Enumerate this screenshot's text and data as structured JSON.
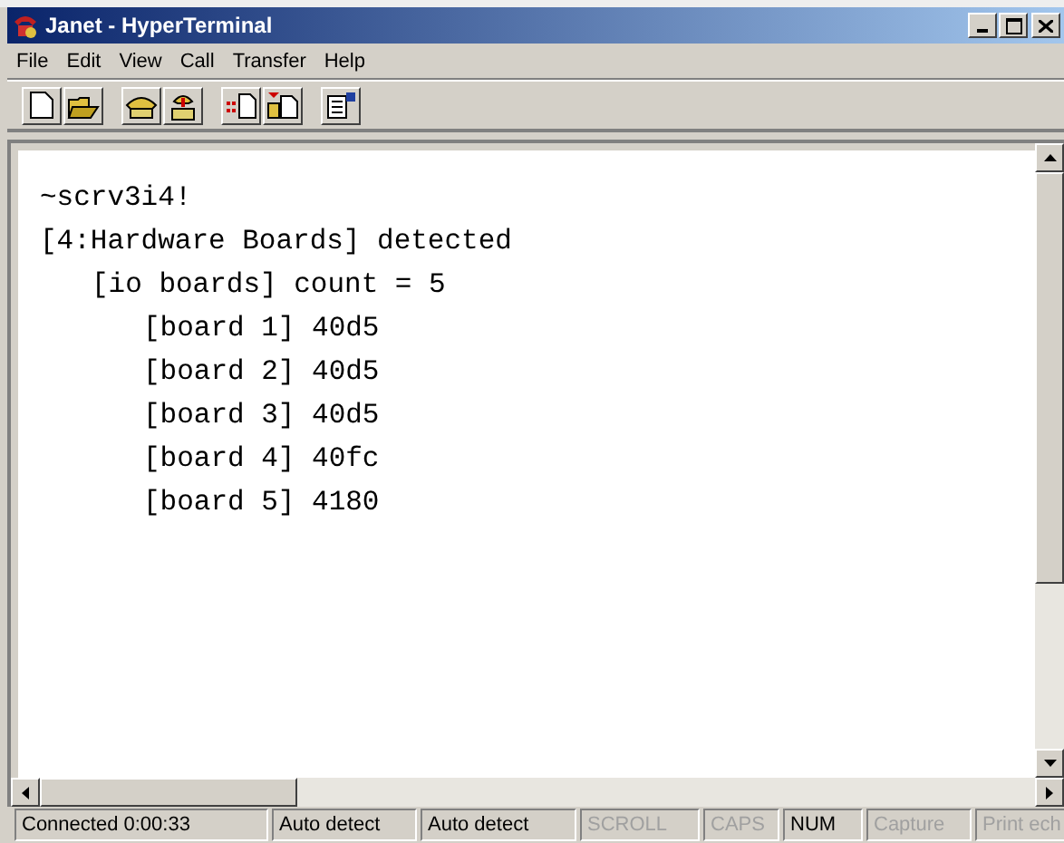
{
  "window": {
    "title": "Janet - HyperTerminal"
  },
  "menu": [
    "File",
    "Edit",
    "View",
    "Call",
    "Transfer",
    "Help"
  ],
  "toolbar": [
    {
      "kind": "new"
    },
    {
      "kind": "open"
    },
    {
      "kind": "call"
    },
    {
      "kind": "hangup"
    },
    {
      "kind": "send"
    },
    {
      "kind": "receive"
    },
    {
      "kind": "properties"
    }
  ],
  "terminal": {
    "lines": [
      {
        "text": "~scrv3i4!"
      },
      {
        "text": "[4:Hardware Boards] detected",
        "children": [
          {
            "text": "[io boards] count = 5",
            "children": [
              {
                "text": "[board 1] 40d5"
              },
              {
                "text": "[board 2] 40d5"
              },
              {
                "text": "[board 3] 40d5"
              },
              {
                "text": "[board 4] 40fc"
              },
              {
                "text": "[board 5] 4180"
              }
            ]
          }
        ]
      }
    ]
  },
  "status_bar": [
    {
      "text": "Connected 0:00:33",
      "disabled": false
    },
    {
      "text": "Auto detect",
      "disabled": false
    },
    {
      "text": "Auto detect",
      "disabled": false
    },
    {
      "text": "SCROLL",
      "disabled": true
    },
    {
      "text": "CAPS",
      "disabled": true
    },
    {
      "text": "NUM",
      "disabled": false
    },
    {
      "text": "Capture",
      "disabled": true
    },
    {
      "text": "Print ech",
      "disabled": true
    }
  ]
}
